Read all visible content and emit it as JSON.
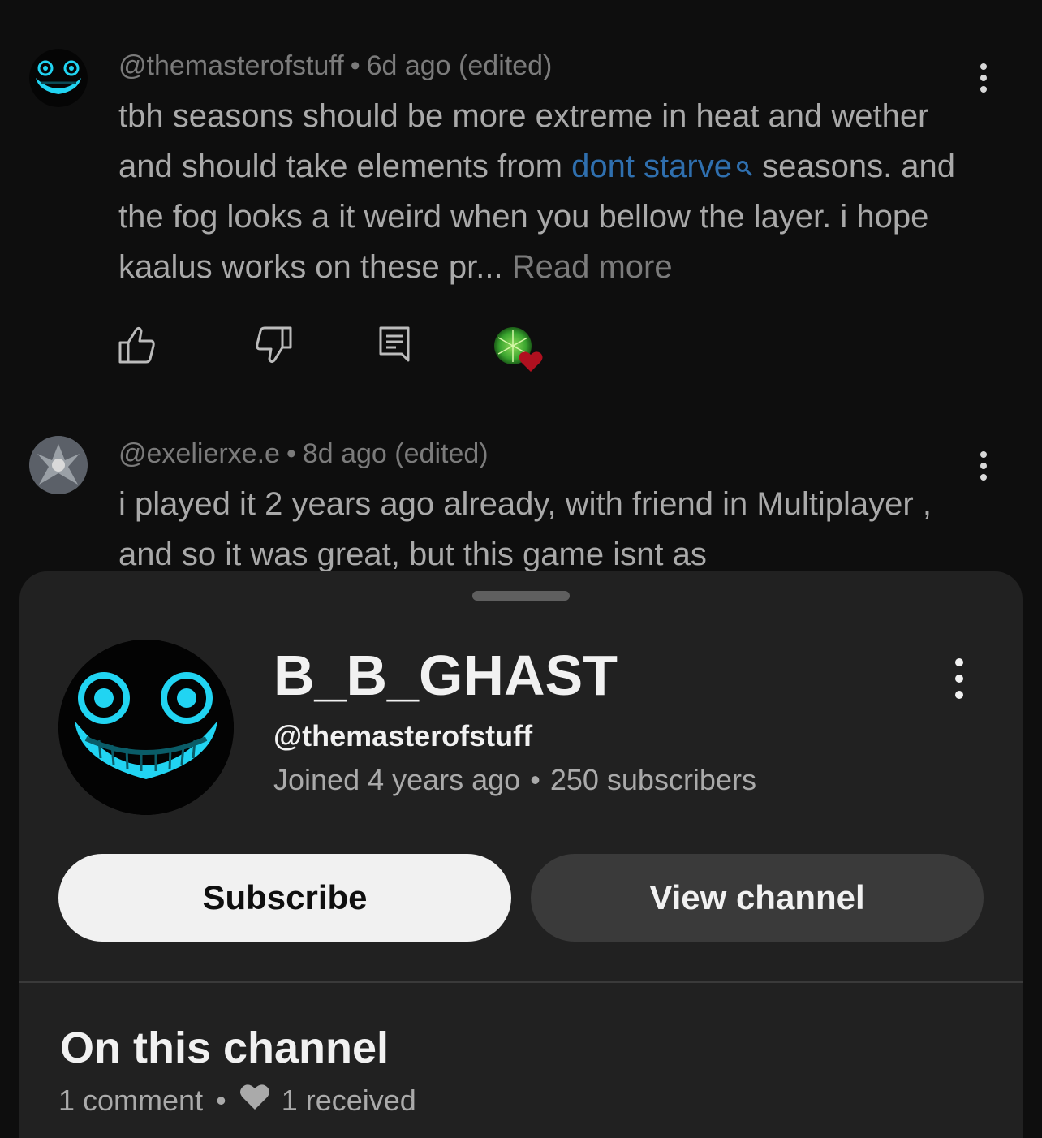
{
  "comments": [
    {
      "handle": "@themasterofstuff",
      "time": "6d ago",
      "edited": "(edited)",
      "text_before_link": "tbh seasons should be more extreme in heat and wether and should take elements from ",
      "link_text": "dont starve",
      "text_after_link": " seasons. and the fog looks a it weird when you bellow the layer. i hope kaalus works on these pr...",
      "read_more": "Read more"
    },
    {
      "handle": "@exelierxe.e",
      "time": "8d ago",
      "edited": "(edited)",
      "text": "i played it 2 years ago already, with friend in Multiplayer , and so  it was great, but this game isnt as"
    }
  ],
  "separator": "•",
  "channel_sheet": {
    "name": "B_B_GHAST",
    "handle": "@themasterofstuff",
    "joined": "Joined 4 years ago",
    "subscribers": "250 subscribers",
    "subscribe_label": "Subscribe",
    "view_channel_label": "View channel",
    "section_title": "On this channel",
    "comment_count": "1 comment",
    "hearts_received": "1 received"
  },
  "icons": {
    "like": "thumbs-up-icon",
    "dislike": "thumbs-down-icon",
    "reply": "reply-icon",
    "creator_heart": "creator-heart-icon",
    "more": "more-vertical-icon",
    "search": "search-icon",
    "heart": "heart-icon"
  },
  "colors": {
    "background": "#0f0f0f",
    "sheet": "#212121",
    "link": "#2f6fae",
    "heart": "#b0101f",
    "avatar_glow": "#21d4f2"
  }
}
